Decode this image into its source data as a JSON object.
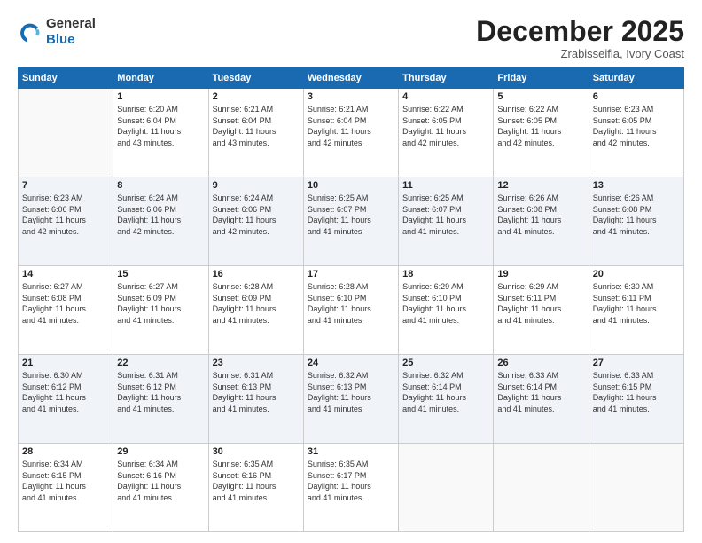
{
  "logo": {
    "general": "General",
    "blue": "Blue"
  },
  "header": {
    "month": "December 2025",
    "location": "Zrabisseifla, Ivory Coast"
  },
  "weekdays": [
    "Sunday",
    "Monday",
    "Tuesday",
    "Wednesday",
    "Thursday",
    "Friday",
    "Saturday"
  ],
  "weeks": [
    [
      {
        "day": "",
        "info": ""
      },
      {
        "day": "1",
        "info": "Sunrise: 6:20 AM\nSunset: 6:04 PM\nDaylight: 11 hours\nand 43 minutes."
      },
      {
        "day": "2",
        "info": "Sunrise: 6:21 AM\nSunset: 6:04 PM\nDaylight: 11 hours\nand 43 minutes."
      },
      {
        "day": "3",
        "info": "Sunrise: 6:21 AM\nSunset: 6:04 PM\nDaylight: 11 hours\nand 42 minutes."
      },
      {
        "day": "4",
        "info": "Sunrise: 6:22 AM\nSunset: 6:05 PM\nDaylight: 11 hours\nand 42 minutes."
      },
      {
        "day": "5",
        "info": "Sunrise: 6:22 AM\nSunset: 6:05 PM\nDaylight: 11 hours\nand 42 minutes."
      },
      {
        "day": "6",
        "info": "Sunrise: 6:23 AM\nSunset: 6:05 PM\nDaylight: 11 hours\nand 42 minutes."
      }
    ],
    [
      {
        "day": "7",
        "info": "Sunrise: 6:23 AM\nSunset: 6:06 PM\nDaylight: 11 hours\nand 42 minutes."
      },
      {
        "day": "8",
        "info": "Sunrise: 6:24 AM\nSunset: 6:06 PM\nDaylight: 11 hours\nand 42 minutes."
      },
      {
        "day": "9",
        "info": "Sunrise: 6:24 AM\nSunset: 6:06 PM\nDaylight: 11 hours\nand 42 minutes."
      },
      {
        "day": "10",
        "info": "Sunrise: 6:25 AM\nSunset: 6:07 PM\nDaylight: 11 hours\nand 41 minutes."
      },
      {
        "day": "11",
        "info": "Sunrise: 6:25 AM\nSunset: 6:07 PM\nDaylight: 11 hours\nand 41 minutes."
      },
      {
        "day": "12",
        "info": "Sunrise: 6:26 AM\nSunset: 6:08 PM\nDaylight: 11 hours\nand 41 minutes."
      },
      {
        "day": "13",
        "info": "Sunrise: 6:26 AM\nSunset: 6:08 PM\nDaylight: 11 hours\nand 41 minutes."
      }
    ],
    [
      {
        "day": "14",
        "info": "Sunrise: 6:27 AM\nSunset: 6:08 PM\nDaylight: 11 hours\nand 41 minutes."
      },
      {
        "day": "15",
        "info": "Sunrise: 6:27 AM\nSunset: 6:09 PM\nDaylight: 11 hours\nand 41 minutes."
      },
      {
        "day": "16",
        "info": "Sunrise: 6:28 AM\nSunset: 6:09 PM\nDaylight: 11 hours\nand 41 minutes."
      },
      {
        "day": "17",
        "info": "Sunrise: 6:28 AM\nSunset: 6:10 PM\nDaylight: 11 hours\nand 41 minutes."
      },
      {
        "day": "18",
        "info": "Sunrise: 6:29 AM\nSunset: 6:10 PM\nDaylight: 11 hours\nand 41 minutes."
      },
      {
        "day": "19",
        "info": "Sunrise: 6:29 AM\nSunset: 6:11 PM\nDaylight: 11 hours\nand 41 minutes."
      },
      {
        "day": "20",
        "info": "Sunrise: 6:30 AM\nSunset: 6:11 PM\nDaylight: 11 hours\nand 41 minutes."
      }
    ],
    [
      {
        "day": "21",
        "info": "Sunrise: 6:30 AM\nSunset: 6:12 PM\nDaylight: 11 hours\nand 41 minutes."
      },
      {
        "day": "22",
        "info": "Sunrise: 6:31 AM\nSunset: 6:12 PM\nDaylight: 11 hours\nand 41 minutes."
      },
      {
        "day": "23",
        "info": "Sunrise: 6:31 AM\nSunset: 6:13 PM\nDaylight: 11 hours\nand 41 minutes."
      },
      {
        "day": "24",
        "info": "Sunrise: 6:32 AM\nSunset: 6:13 PM\nDaylight: 11 hours\nand 41 minutes."
      },
      {
        "day": "25",
        "info": "Sunrise: 6:32 AM\nSunset: 6:14 PM\nDaylight: 11 hours\nand 41 minutes."
      },
      {
        "day": "26",
        "info": "Sunrise: 6:33 AM\nSunset: 6:14 PM\nDaylight: 11 hours\nand 41 minutes."
      },
      {
        "day": "27",
        "info": "Sunrise: 6:33 AM\nSunset: 6:15 PM\nDaylight: 11 hours\nand 41 minutes."
      }
    ],
    [
      {
        "day": "28",
        "info": "Sunrise: 6:34 AM\nSunset: 6:15 PM\nDaylight: 11 hours\nand 41 minutes."
      },
      {
        "day": "29",
        "info": "Sunrise: 6:34 AM\nSunset: 6:16 PM\nDaylight: 11 hours\nand 41 minutes."
      },
      {
        "day": "30",
        "info": "Sunrise: 6:35 AM\nSunset: 6:16 PM\nDaylight: 11 hours\nand 41 minutes."
      },
      {
        "day": "31",
        "info": "Sunrise: 6:35 AM\nSunset: 6:17 PM\nDaylight: 11 hours\nand 41 minutes."
      },
      {
        "day": "",
        "info": ""
      },
      {
        "day": "",
        "info": ""
      },
      {
        "day": "",
        "info": ""
      }
    ]
  ]
}
